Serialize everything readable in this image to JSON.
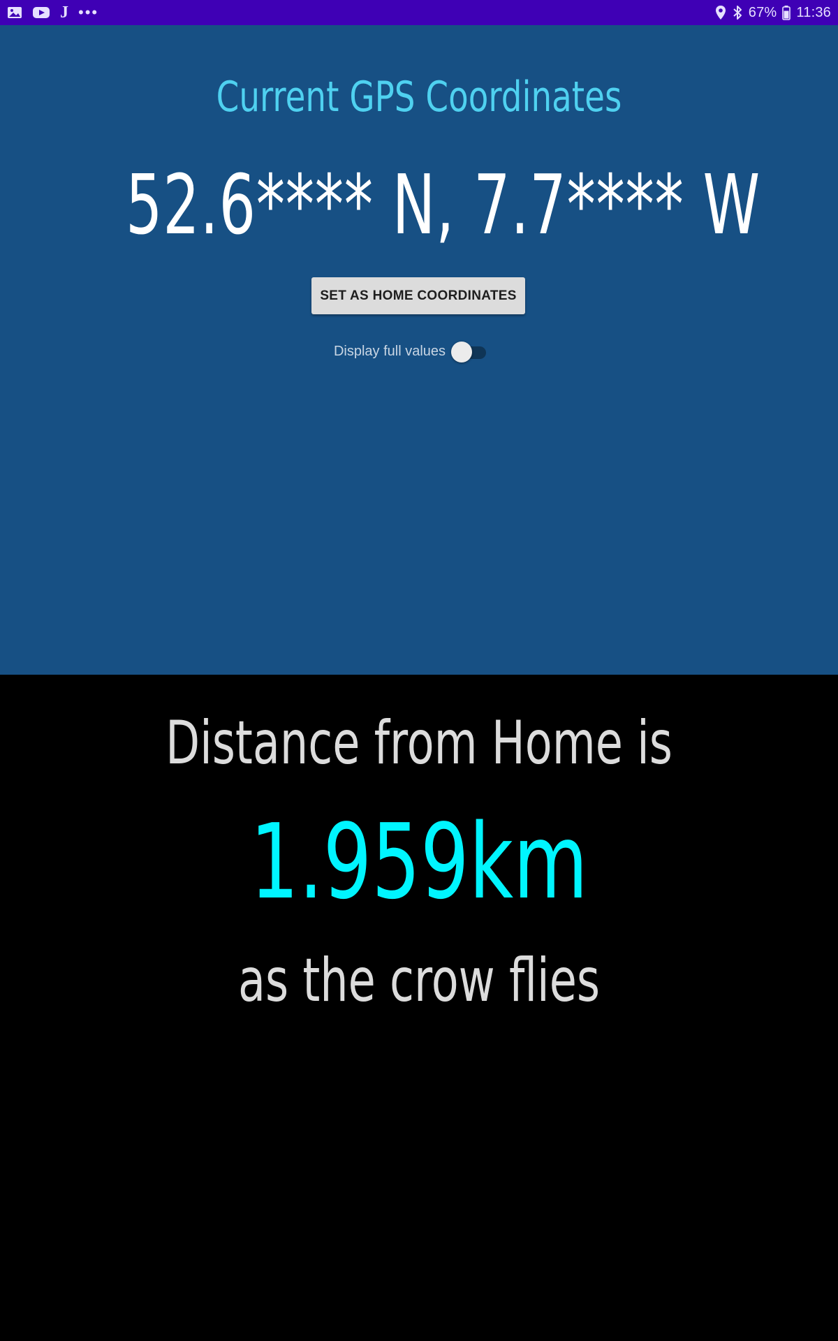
{
  "status_bar": {
    "left_icons": [
      "gallery-icon",
      "youtube-icon",
      "j-app-icon",
      "more-notifications-icon"
    ],
    "j_glyph": "J",
    "more_glyph": "•••",
    "right_icons": [
      "location-icon",
      "bluetooth-icon",
      "battery-icon"
    ],
    "battery_percent": "67%",
    "time": "11:36",
    "background_color": "#3f00b5"
  },
  "gps": {
    "title": "Current GPS Coordinates",
    "coordinates": "52.6**** N, 7.7**** W",
    "set_home_button": "SET AS HOME COORDINATES",
    "toggle_label": "Display full values",
    "toggle_on": false,
    "background_color": "#175084",
    "title_color": "#4fd1f0"
  },
  "distance": {
    "heading": "Distance from Home is",
    "value": "1.959km",
    "caption": "as the crow flies",
    "value_color": "#00f5ff",
    "background_color": "#000000"
  }
}
